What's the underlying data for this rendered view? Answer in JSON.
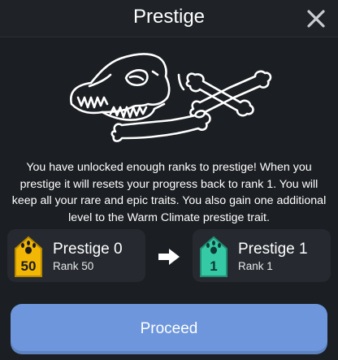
{
  "dialog": {
    "title": "Prestige",
    "description": "You have unlocked enough ranks to prestige! When you prestige it will resets your progress back to rank 1. You will keep all your rare and epic traits. You also gain one additional level to the Warm Climate prestige trait."
  },
  "current": {
    "badge_number": "50",
    "title": "Prestige 0",
    "rank": "Rank 50",
    "badge_color": "#f2b705"
  },
  "next": {
    "badge_number": "1",
    "title": "Prestige 1",
    "rank": "Rank 1",
    "badge_color": "#35c9a6"
  },
  "actions": {
    "proceed_label": "Proceed"
  },
  "icons": {
    "close": "close-icon",
    "arrow": "arrow-right-icon",
    "artwork": "dinosaur-skull-and-bones-illustration",
    "badge_emblem": "dino-footprint-icon"
  },
  "colors": {
    "accent_button": "#6d96dc",
    "gold_badge": "#f2b705",
    "teal_badge": "#35c9a6"
  }
}
